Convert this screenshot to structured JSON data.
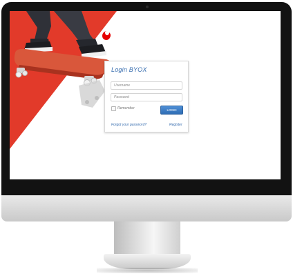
{
  "brand": {
    "accent": "#e23a2a",
    "logo_color": "#e60000"
  },
  "login": {
    "title": "Login BYOX",
    "username_placeholder": "Username",
    "password_placeholder": "Password",
    "remember_label": "Remember",
    "login_button": "LOGIN",
    "forgot_link": "Forgot your password?",
    "register_link": "Register"
  },
  "colors": {
    "title_blue": "#3a6fb0",
    "button_blue": "#2e6db4",
    "bezel": "#121212"
  }
}
